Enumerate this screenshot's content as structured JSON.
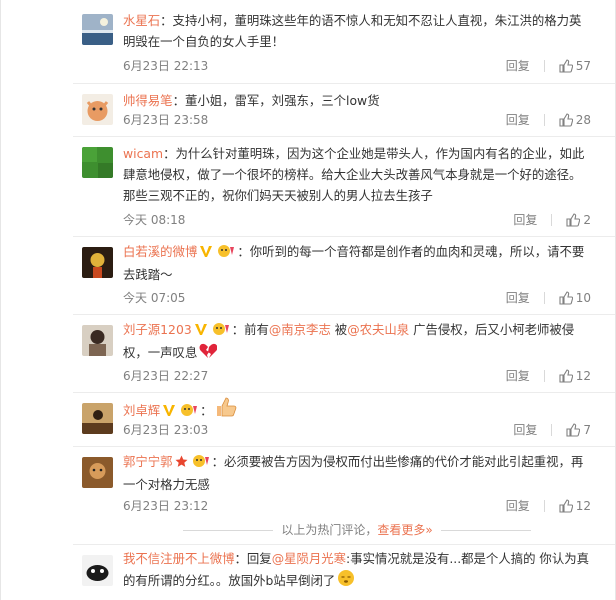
{
  "comments": [
    {
      "username": "水星石",
      "text": "：支持小柯，董明珠这些年的语不惊人和无知不忍让人直视，朱江洪的格力英明毁在一个自负的女人手里！",
      "time": "6月23日 22:13",
      "reply": "回复",
      "likes": "57"
    },
    {
      "username": "帅得易笔",
      "text": "：董小姐，雷军，刘强东，三个low货",
      "time": "6月23日 23:58",
      "reply": "回复",
      "likes": "28"
    },
    {
      "username": "wicam",
      "text": "：为什么针对董明珠，因为这个企业她是带头人，作为国内有名的企业，如此肆意地侵权，做了一个很坏的榜样。给大企业大头改善风气本身就是一个好的途径。那些三观不正的，祝你们妈天天被别人的男人拉去生孩子",
      "time": "今天 08:18",
      "reply": "回复",
      "likes": "2"
    },
    {
      "username": "白若溪的微博",
      "text": "：你听到的每一个音符都是创作者的血肉和灵魂，所以，请不要去践踏～",
      "time": "今天 07:05",
      "reply": "回复",
      "likes": "10"
    },
    {
      "username": "刘子源1203",
      "text_a": "：前有",
      "mention_1": "@南京李志",
      "text_b": " 被",
      "mention_2": "@农夫山泉",
      "text_c": " 广告侵权，后又小柯老师被侵权，一声叹息",
      "time": "6月23日 22:27",
      "reply": "回复",
      "likes": "12"
    },
    {
      "username": "刘卓辉",
      "text": "：",
      "time": "6月23日 23:03",
      "reply": "回复",
      "likes": "7"
    },
    {
      "username": "郭宁宁郭",
      "text": "：必须要被告方因为侵权而付出些惨痛的代价才能对此引起重视，再一个对格力无感",
      "time": "6月23日 23:12",
      "reply": "回复",
      "likes": "12"
    },
    {
      "username": "我不信注册不上微博",
      "text_a": "：回复",
      "mention_1": "@星陨月光寒",
      "text_b": ":事实情况就是没有...都是个人搞的 你认为真的有所谓的分红。。放国外b站早倒闭了"
    }
  ],
  "hot_divider": {
    "text": "以上为热门评论，",
    "more_link": "查看更多»"
  }
}
